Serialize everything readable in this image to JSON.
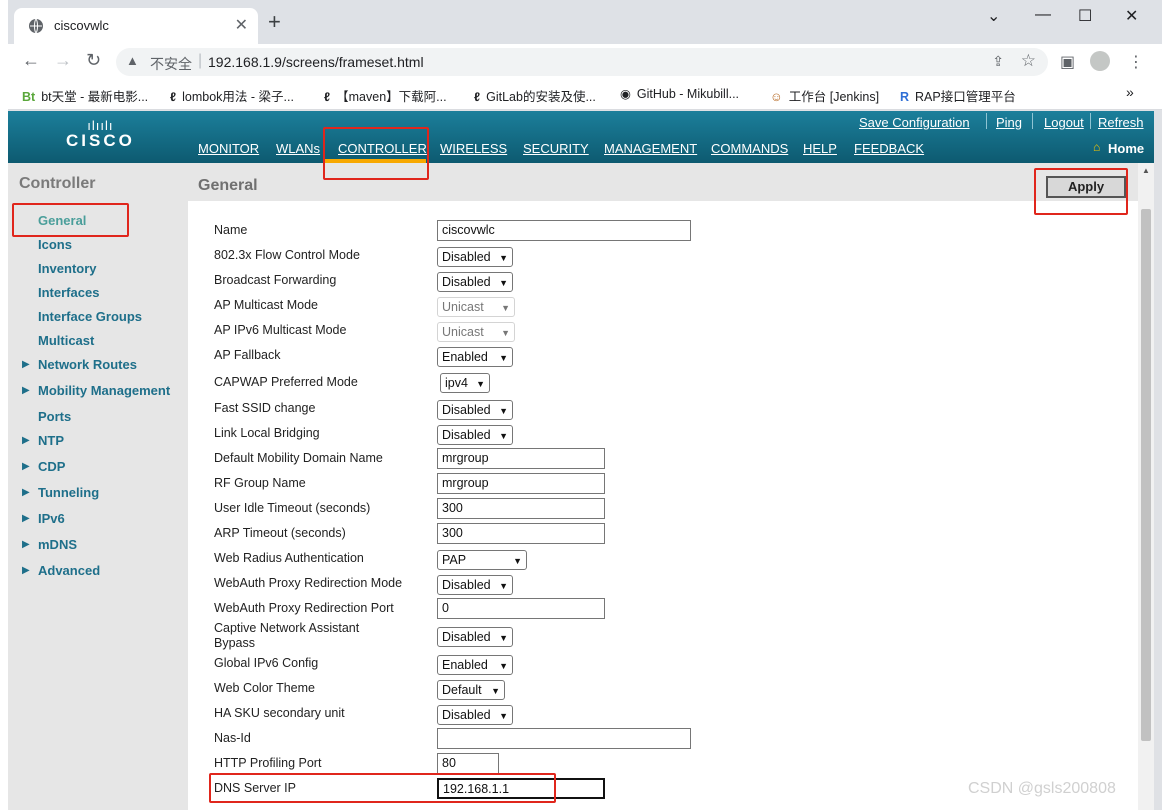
{
  "browser": {
    "tab_title": "ciscovwlc",
    "new_tab": "+",
    "insecure_label": "不安全",
    "url": "192.168.1.9/screens/frameset.html",
    "bookmarks": [
      {
        "icon": "Bt",
        "label": "bt天堂 - 最新电影..."
      },
      {
        "icon": "ℓ",
        "label": "lombok用法 - 梁子..."
      },
      {
        "icon": "ℓ",
        "label": "【maven】下载阿..."
      },
      {
        "icon": "ℓ",
        "label": "GitLab的安装及使..."
      },
      {
        "icon": "◉",
        "label": "GitHub - Mikubill..."
      },
      {
        "icon": "☺",
        "label": "工作台 [Jenkins]"
      },
      {
        "icon": "R",
        "label": "RAP接口管理平台"
      }
    ],
    "bookmarks_more": "»"
  },
  "header": {
    "brand": "CISCO",
    "brand_bars": "ılıılı",
    "top_links": [
      "Save Configuration",
      "Ping",
      "Logout",
      "Refresh"
    ],
    "nav": [
      "MONITOR",
      "WLANs",
      "CONTROLLER",
      "WIRELESS",
      "SECURITY",
      "MANAGEMENT",
      "COMMANDS",
      "HELP",
      "FEEDBACK"
    ],
    "active_nav": "CONTROLLER",
    "home": "Home"
  },
  "sidebar": {
    "title": "Controller",
    "items": [
      {
        "label": "General",
        "selected": true,
        "expandable": false
      },
      {
        "label": "Icons",
        "expandable": false
      },
      {
        "label": "Inventory",
        "expandable": false
      },
      {
        "label": "Interfaces",
        "expandable": false
      },
      {
        "label": "Interface Groups",
        "expandable": false
      },
      {
        "label": "Multicast",
        "expandable": false
      },
      {
        "label": "Network Routes",
        "expandable": true
      },
      {
        "label": "Mobility Management",
        "expandable": true
      },
      {
        "label": "Ports",
        "expandable": false
      },
      {
        "label": "NTP",
        "expandable": true
      },
      {
        "label": "CDP",
        "expandable": true
      },
      {
        "label": "Tunneling",
        "expandable": true
      },
      {
        "label": "IPv6",
        "expandable": true
      },
      {
        "label": "mDNS",
        "expandable": true
      },
      {
        "label": "Advanced",
        "expandable": true
      }
    ]
  },
  "main": {
    "title": "General",
    "apply": "Apply",
    "fields": [
      {
        "label": "Name",
        "value": "ciscovwlc"
      },
      {
        "label": "802.3x Flow Control Mode",
        "value": "Disabled"
      },
      {
        "label": "Broadcast Forwarding",
        "value": "Disabled"
      },
      {
        "label": "AP Multicast Mode",
        "value": "Unicast"
      },
      {
        "label": "AP IPv6 Multicast Mode",
        "value": "Unicast"
      },
      {
        "label": "AP Fallback",
        "value": "Enabled"
      },
      {
        "label": "CAPWAP Preferred Mode",
        "value": "ipv4"
      },
      {
        "label": "Fast SSID change",
        "value": "Disabled"
      },
      {
        "label": "Link Local Bridging",
        "value": "Disabled"
      },
      {
        "label": "Default Mobility Domain Name",
        "value": "mrgroup"
      },
      {
        "label": "RF Group Name",
        "value": "mrgroup"
      },
      {
        "label": "User Idle Timeout (seconds)",
        "value": "300"
      },
      {
        "label": "ARP Timeout (seconds)",
        "value": "300"
      },
      {
        "label": "Web Radius Authentication",
        "value": "PAP"
      },
      {
        "label": "WebAuth Proxy Redirection Mode",
        "value": "Disabled"
      },
      {
        "label": "WebAuth Proxy Redirection Port",
        "value": "0"
      },
      {
        "label": "Captive Network Assistant Bypass",
        "value": "Disabled"
      },
      {
        "label": "Global IPv6 Config",
        "value": "Enabled"
      },
      {
        "label": "Web Color Theme",
        "value": "Default"
      },
      {
        "label": "HA SKU secondary unit",
        "value": "Disabled"
      },
      {
        "label": "Nas-Id",
        "value": ""
      },
      {
        "label": "HTTP Profiling Port",
        "value": "80"
      },
      {
        "label": "DNS Server IP",
        "value": "192.168.1.1"
      }
    ]
  },
  "watermark": "CSDN @gsls200808"
}
